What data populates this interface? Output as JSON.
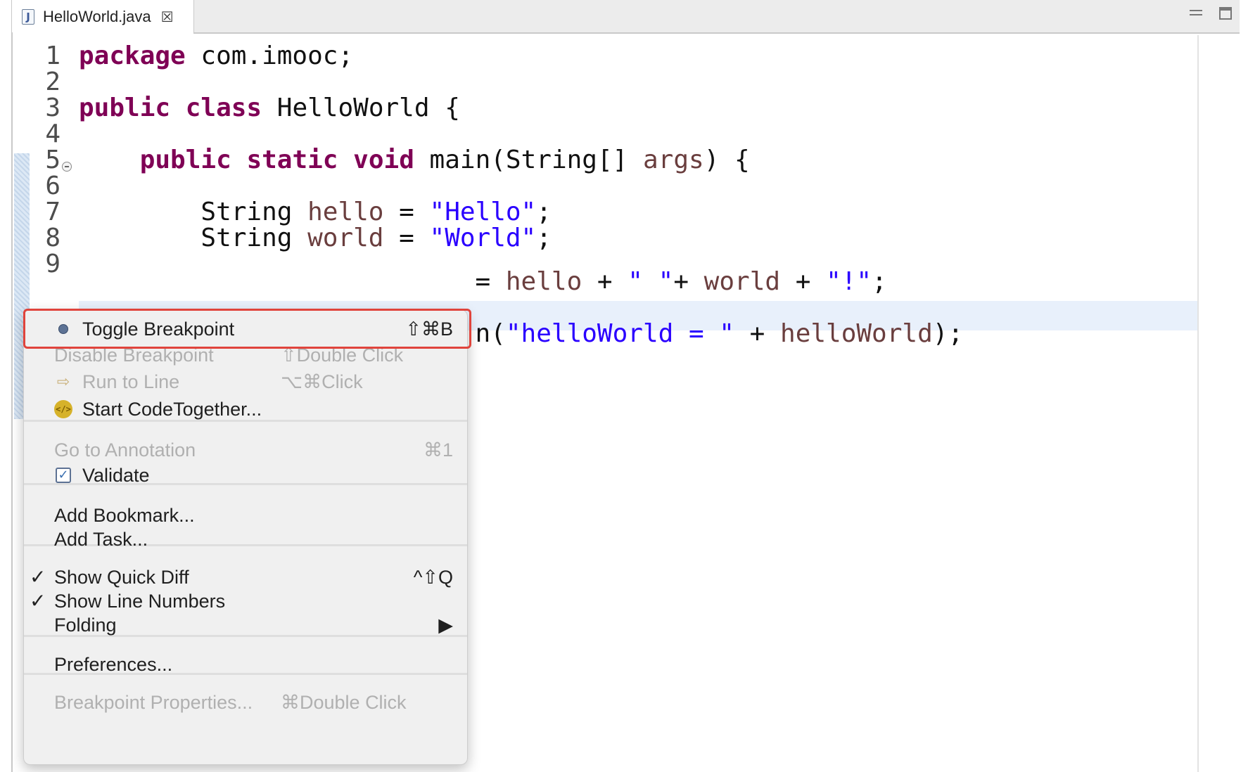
{
  "tab": {
    "title": "HelloWorld.java",
    "icon": "java-file-icon",
    "close": "☒"
  },
  "code_lines": [
    {
      "n": "1",
      "segments": [
        {
          "t": "package",
          "c": "kw"
        },
        {
          "t": " com.imooc;",
          "c": ""
        }
      ]
    },
    {
      "n": "2",
      "segments": []
    },
    {
      "n": "3",
      "segments": [
        {
          "t": "public",
          "c": "kw"
        },
        {
          "t": " ",
          "c": ""
        },
        {
          "t": "class",
          "c": "kw"
        },
        {
          "t": " HelloWorld {",
          "c": ""
        }
      ]
    },
    {
      "n": "4",
      "segments": []
    },
    {
      "n": "5",
      "segments": [
        {
          "t": "    ",
          "c": ""
        },
        {
          "t": "public",
          "c": "kw"
        },
        {
          "t": " ",
          "c": ""
        },
        {
          "t": "static",
          "c": "kw"
        },
        {
          "t": " ",
          "c": ""
        },
        {
          "t": "void",
          "c": "kw"
        },
        {
          "t": " main(String[] ",
          "c": ""
        },
        {
          "t": "args",
          "c": "var"
        },
        {
          "t": ") {",
          "c": ""
        }
      ]
    },
    {
      "n": "6",
      "segments": []
    },
    {
      "n": "7",
      "segments": [
        {
          "t": "        String ",
          "c": ""
        },
        {
          "t": "hello",
          "c": "var"
        },
        {
          "t": " = ",
          "c": ""
        },
        {
          "t": "\"Hello\"",
          "c": "str"
        },
        {
          "t": ";",
          "c": ""
        }
      ]
    },
    {
      "n": "8",
      "segments": [
        {
          "t": "        String ",
          "c": ""
        },
        {
          "t": "world",
          "c": "var"
        },
        {
          "t": " = ",
          "c": ""
        },
        {
          "t": "\"World\"",
          "c": "str"
        },
        {
          "t": ";",
          "c": ""
        }
      ]
    },
    {
      "n": "9",
      "segments": []
    },
    {
      "n": "",
      "segments": [
        {
          "t": "                          = ",
          "c": ""
        },
        {
          "t": "hello",
          "c": "var"
        },
        {
          "t": " + ",
          "c": ""
        },
        {
          "t": "\" \"",
          "c": "str"
        },
        {
          "t": "+ ",
          "c": ""
        },
        {
          "t": "world",
          "c": "var"
        },
        {
          "t": " + ",
          "c": ""
        },
        {
          "t": "\"!\"",
          "c": "str"
        },
        {
          "t": ";",
          "c": ""
        }
      ]
    },
    {
      "n": "",
      "segments": []
    },
    {
      "n": "",
      "segments": [
        {
          "t": "                          n(",
          "c": ""
        },
        {
          "t": "\"helloWorld = \"",
          "c": "str"
        },
        {
          "t": " + ",
          "c": ""
        },
        {
          "t": "helloWorld",
          "c": "var"
        },
        {
          "t": ");",
          "c": ""
        }
      ]
    }
  ],
  "context_menu": {
    "items": [
      {
        "label": "Toggle Breakpoint",
        "shortcut": "⇧⌘B",
        "icon": "breakpoint-dot-icon",
        "enabled": true
      },
      {
        "label": "Disable Breakpoint",
        "shortcut": "⇧Double Click",
        "enabled": false
      },
      {
        "label": "Run to Line",
        "shortcut": "⌥⌘Click",
        "icon": "run-to-line-icon",
        "enabled": false
      },
      {
        "label": "Start CodeTogether...",
        "icon": "codetogether-icon",
        "enabled": true
      },
      {
        "label": "Go to Annotation",
        "shortcut": "⌘1",
        "enabled": false
      },
      {
        "label": "Validate",
        "icon": "checkbox-icon",
        "enabled": true
      },
      {
        "label": "Add Bookmark...",
        "enabled": true
      },
      {
        "label": "Add Task...",
        "enabled": true
      },
      {
        "label": "Show Quick Diff",
        "shortcut": "^⇧Q",
        "checked": true,
        "enabled": true
      },
      {
        "label": "Show Line Numbers",
        "checked": true,
        "enabled": true
      },
      {
        "label": "Folding",
        "submenu": "▶",
        "enabled": true
      },
      {
        "label": "Preferences...",
        "enabled": true
      },
      {
        "label": "Breakpoint Properties...",
        "shortcut": "⌘Double Click",
        "enabled": false
      }
    ]
  },
  "colors": {
    "keyword": "#7f0055",
    "string": "#2a00ff",
    "variable": "#6a3e3e",
    "highlight": "#e0443c"
  }
}
